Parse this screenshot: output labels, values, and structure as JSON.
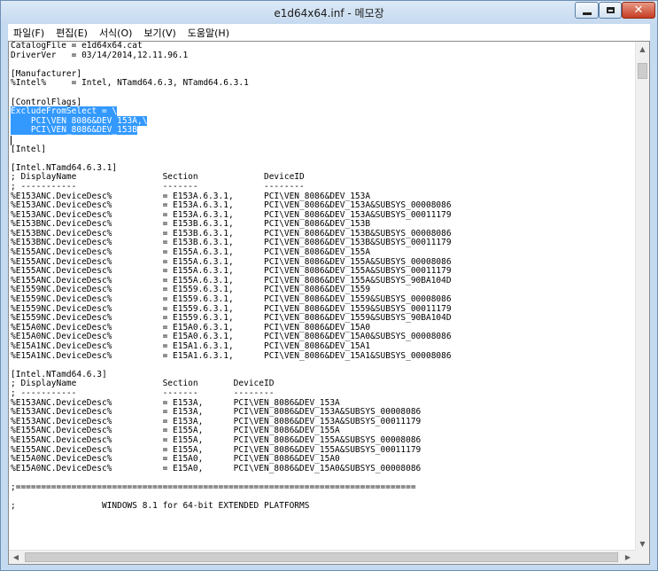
{
  "window": {
    "title": "e1d64x64.inf - 메모장",
    "close_glyph": "✕"
  },
  "menu": [
    {
      "label": "파일(F)"
    },
    {
      "label": "편집(E)"
    },
    {
      "label": "서식(O)"
    },
    {
      "label": "보기(V)"
    },
    {
      "label": "도움말(H)"
    }
  ],
  "editor": {
    "lines": [
      "CatalogFile = e1d64x64.cat",
      "DriverVer   = 03/14/2014,12.11.96.1",
      "",
      "[Manufacturer]",
      "%Intel%     = Intel, NTamd64.6.3, NTamd64.6.3.1",
      "",
      "[ControlFlags]",
      "ExcludeFromSelect = \\",
      "    PCI\\VEN_8086&DEV_153A,\\",
      "    PCI\\VEN_8086&DEV_153B",
      "",
      "[Intel]",
      "",
      "[Intel.NTamd64.6.3.1]",
      "; DisplayName                 Section             DeviceID",
      "; -----------                 -------             --------",
      "%E153ANC.DeviceDesc%          = E153A.6.3.1,      PCI\\VEN_8086&DEV_153A",
      "%E153ANC.DeviceDesc%          = E153A.6.3.1,      PCI\\VEN_8086&DEV_153A&SUBSYS_00008086",
      "%E153ANC.DeviceDesc%          = E153A.6.3.1,      PCI\\VEN_8086&DEV_153A&SUBSYS_00011179",
      "%E153BNC.DeviceDesc%          = E153B.6.3.1,      PCI\\VEN_8086&DEV_153B",
      "%E153BNC.DeviceDesc%          = E153B.6.3.1,      PCI\\VEN_8086&DEV_153B&SUBSYS_00008086",
      "%E153BNC.DeviceDesc%          = E153B.6.3.1,      PCI\\VEN_8086&DEV_153B&SUBSYS_00011179",
      "%E155ANC.DeviceDesc%          = E155A.6.3.1,      PCI\\VEN_8086&DEV_155A",
      "%E155ANC.DeviceDesc%          = E155A.6.3.1,      PCI\\VEN_8086&DEV_155A&SUBSYS_00008086",
      "%E155ANC.DeviceDesc%          = E155A.6.3.1,      PCI\\VEN_8086&DEV_155A&SUBSYS_00011179",
      "%E155ANC.DeviceDesc%          = E155A.6.3.1,      PCI\\VEN_8086&DEV_155A&SUBSYS_90BA104D",
      "%E1559NC.DeviceDesc%          = E1559.6.3.1,      PCI\\VEN_8086&DEV_1559",
      "%E1559NC.DeviceDesc%          = E1559.6.3.1,      PCI\\VEN_8086&DEV_1559&SUBSYS_00008086",
      "%E1559NC.DeviceDesc%          = E1559.6.3.1,      PCI\\VEN_8086&DEV_1559&SUBSYS_00011179",
      "%E1559NC.DeviceDesc%          = E1559.6.3.1,      PCI\\VEN_8086&DEV_1559&SUBSYS_90BA104D",
      "%E15A0NC.DeviceDesc%          = E15A0.6.3.1,      PCI\\VEN_8086&DEV_15A0",
      "%E15A0NC.DeviceDesc%          = E15A0.6.3.1,      PCI\\VEN_8086&DEV_15A0&SUBSYS_00008086",
      "%E15A1NC.DeviceDesc%          = E15A1.6.3.1,      PCI\\VEN_8086&DEV_15A1",
      "%E15A1NC.DeviceDesc%          = E15A1.6.3.1,      PCI\\VEN_8086&DEV_15A1&SUBSYS_00008086",
      "",
      "[Intel.NTamd64.6.3]",
      "; DisplayName                 Section       DeviceID",
      "; -----------                 -------       --------",
      "%E153ANC.DeviceDesc%          = E153A,      PCI\\VEN_8086&DEV_153A",
      "%E153ANC.DeviceDesc%          = E153A,      PCI\\VEN_8086&DEV_153A&SUBSYS_00008086",
      "%E153ANC.DeviceDesc%          = E153A,      PCI\\VEN_8086&DEV_153A&SUBSYS_00011179",
      "%E155ANC.DeviceDesc%          = E155A,      PCI\\VEN_8086&DEV_155A",
      "%E155ANC.DeviceDesc%          = E155A,      PCI\\VEN_8086&DEV_155A&SUBSYS_00008086",
      "%E155ANC.DeviceDesc%          = E155A,      PCI\\VEN_8086&DEV_155A&SUBSYS_00011179",
      "%E15A0NC.DeviceDesc%          = E15A0,      PCI\\VEN_8086&DEV_15A0",
      "%E15A0NC.DeviceDesc%          = E15A0,      PCI\\VEN_8086&DEV_15A0&SUBSYS_00008086",
      "",
      ";===============================================================================",
      "",
      ";                 WINDOWS 8.1 for 64-bit EXTENDED PLATFORMS"
    ],
    "selected_lines": [
      7,
      8,
      9
    ]
  },
  "scrollbar": {
    "up_glyph": "▲",
    "down_glyph": "▼",
    "left_glyph": "◀",
    "right_glyph": "▶"
  }
}
